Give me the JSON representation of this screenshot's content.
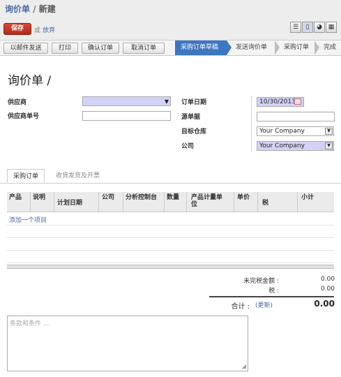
{
  "breadcrumb": {
    "parent": "询价单",
    "separator": "/",
    "current": "新建"
  },
  "form_buttons": {
    "save": "保存",
    "or": "或",
    "discard": "放弃"
  },
  "view_switcher": [
    {
      "icon": "list-view-icon",
      "glyph": "☰"
    },
    {
      "icon": "form-view-icon",
      "glyph": "▯"
    },
    {
      "icon": "graph-view-icon",
      "glyph": "◕"
    },
    {
      "icon": "calendar-view-icon",
      "glyph": "▦"
    }
  ],
  "actions": {
    "email": "以邮件发送",
    "print": "打印",
    "confirm": "确认订单",
    "cancel": "取消订单"
  },
  "status_steps": [
    {
      "label": "采购订单草稿",
      "active": true
    },
    {
      "label": "发送询价单",
      "active": false
    },
    {
      "label": "采购订单",
      "active": false
    },
    {
      "label": "完成",
      "active": false
    }
  ],
  "title": "询价单 /",
  "fields": {
    "supplier_label": "供应商",
    "supplier_value": "",
    "supplier_ref_label": "供应商单号",
    "supplier_ref_value": "",
    "order_date_label": "订单日期",
    "order_date_value": "10/30/2013",
    "source_doc_label": "源单据",
    "source_doc_value": "",
    "warehouse_label": "目标仓库",
    "warehouse_value": "Your Company",
    "company_label": "公司",
    "company_value": "Your Company"
  },
  "tabs": {
    "active": "采购订单",
    "other": "收货发货及开票"
  },
  "lines_table": {
    "columns": [
      "产品",
      "说明",
      "计划日期",
      "公司",
      "分析控制台",
      "数量",
      "产品计量单位",
      "单价",
      "税",
      "小计"
    ],
    "add_item": "添加一个项目"
  },
  "totals": {
    "untaxed_label": "未完税金额 :",
    "untaxed_value": "0.00",
    "tax_label": "税 :",
    "tax_value": "0.00",
    "total_label": "合计 :",
    "update_link": "(更新)",
    "total_value": "0.00"
  },
  "notes_placeholder": "条款和条件 ..."
}
